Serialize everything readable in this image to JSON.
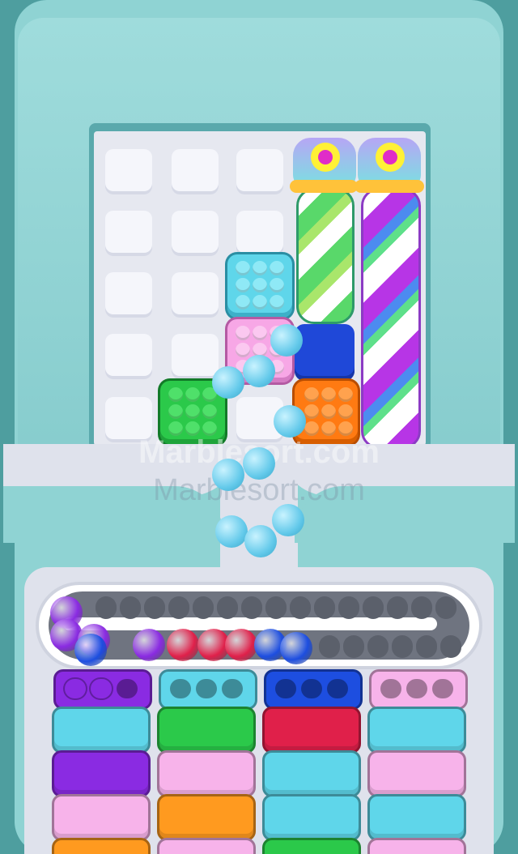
{
  "watermark": {
    "primary": "Marblesort.com",
    "secondary": "Marblesort.com"
  },
  "colors": {
    "frame": "#4e9e9f",
    "board": "#e6e8f0",
    "marble_cyan": "#63c9ea",
    "marble_purple": "#8a2be2",
    "marble_red": "#e0204a",
    "marble_blue": "#1d4ee0",
    "block_cyan": "#5fd6ea",
    "block_pink": "#f59ae0",
    "block_green": "#2bc94a",
    "block_blue": "#1f48d8",
    "block_orange": "#ff7a12"
  },
  "blocks": [
    {
      "name": "cyan-block",
      "color": "cyan"
    },
    {
      "name": "pink-block",
      "color": "pink"
    },
    {
      "name": "green-block",
      "color": "green"
    },
    {
      "name": "blue-block",
      "color": "blue"
    },
    {
      "name": "orange-block",
      "color": "orange"
    }
  ],
  "tubes": [
    {
      "name": "green-striped-tube",
      "stripe": "green"
    },
    {
      "name": "purple-striped-tube",
      "stripe": "purple"
    }
  ],
  "conveyor": {
    "marbles": [
      "purple",
      "purple",
      "purple",
      "purple",
      "red",
      "red",
      "red",
      "blue",
      "blue",
      "blue"
    ]
  },
  "bins": [
    {
      "name": "purple-bin",
      "top_color": "purple",
      "filled": 2,
      "capacity": 3,
      "layers": [
        "cyan",
        "purple",
        "pink",
        "orange"
      ]
    },
    {
      "name": "cyan-bin",
      "top_color": "cyan",
      "filled": 0,
      "capacity": 3,
      "layers": [
        "green",
        "pink",
        "orange",
        "pink"
      ]
    },
    {
      "name": "blue-bin",
      "top_color": "blue",
      "filled": 0,
      "capacity": 3,
      "layers": [
        "red",
        "cyan",
        "cyan",
        "green"
      ]
    },
    {
      "name": "pink-bin",
      "top_color": "pink",
      "filled": 0,
      "capacity": 3,
      "layers": [
        "cyan",
        "pink",
        "cyan",
        "pink"
      ]
    }
  ]
}
